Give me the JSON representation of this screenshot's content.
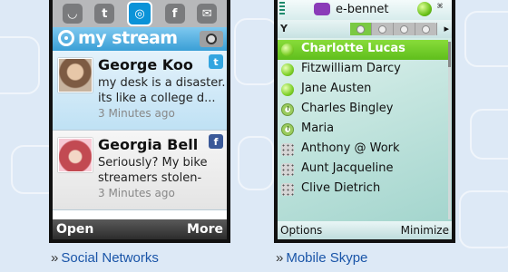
{
  "social_phone": {
    "icon_bar": [
      {
        "icon": "rss-icon",
        "glyph": "◡"
      },
      {
        "icon": "twitter-icon",
        "glyph": "t"
      },
      {
        "icon": "mystream-icon",
        "glyph": "◎"
      },
      {
        "icon": "facebook-icon",
        "glyph": "f"
      },
      {
        "icon": "mail-icon",
        "glyph": "✉"
      }
    ],
    "header_title": "my stream",
    "posts": [
      {
        "name": "George Koo",
        "line1": "my desk is a disaster.",
        "line2": "its like a college d...",
        "time": "3 Minutes ago",
        "network": "twitter",
        "network_glyph": "t"
      },
      {
        "name": "Georgia Bell",
        "line1": "Seriously? My bike",
        "line2": "streamers stolen-",
        "time": "3 Minutes ago",
        "network": "facebook",
        "network_glyph": "f"
      }
    ],
    "softkeys": {
      "left": "Open",
      "right": "More"
    }
  },
  "skype_phone": {
    "username": "e-bennet",
    "antenna_label": "Y",
    "arrow_glyph": "▸",
    "corner_glyph": "⌘",
    "contacts": [
      {
        "name": "Charlotte Lucas",
        "status": "online",
        "selected": true
      },
      {
        "name": "Fitzwilliam Darcy",
        "status": "online",
        "selected": false
      },
      {
        "name": "Jane Austen",
        "status": "online",
        "selected": false
      },
      {
        "name": "Charles Bingley",
        "status": "away",
        "selected": false
      },
      {
        "name": "Maria",
        "status": "away",
        "selected": false
      },
      {
        "name": "Anthony @ Work",
        "status": "phone",
        "selected": false
      },
      {
        "name": "Aunt Jacqueline",
        "status": "phone",
        "selected": false
      },
      {
        "name": "Clive Dietrich",
        "status": "phone",
        "selected": false
      }
    ],
    "softkeys": {
      "left": "Options",
      "right": "Minimize"
    }
  },
  "captions": {
    "left": "Social Networks",
    "right": "Mobile Skype",
    "marker": "»"
  },
  "colors": {
    "page_background": "#dde9f6",
    "caption_link": "#1a55a8",
    "skype_selected": "#6cc826",
    "stream_blue": "#3a9fd6"
  }
}
